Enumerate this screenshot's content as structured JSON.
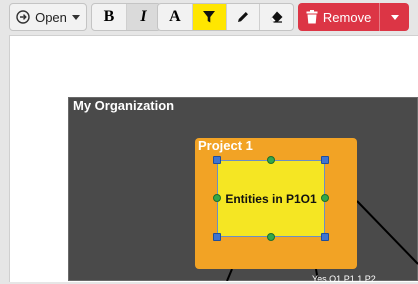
{
  "toolbar": {
    "open_label": "Open",
    "bold_label": "B",
    "italic_label": "I",
    "font_color_label": "A",
    "remove_label": "Remove",
    "highlight_color": "#ffe600",
    "remove_color": "#dc3545"
  },
  "diagram": {
    "organization_title": "My Organization",
    "project_title": "Project 1",
    "entities_label": "Entities in P1O1",
    "edge_label_partial": "Yes  O1  P1  1  P2"
  }
}
